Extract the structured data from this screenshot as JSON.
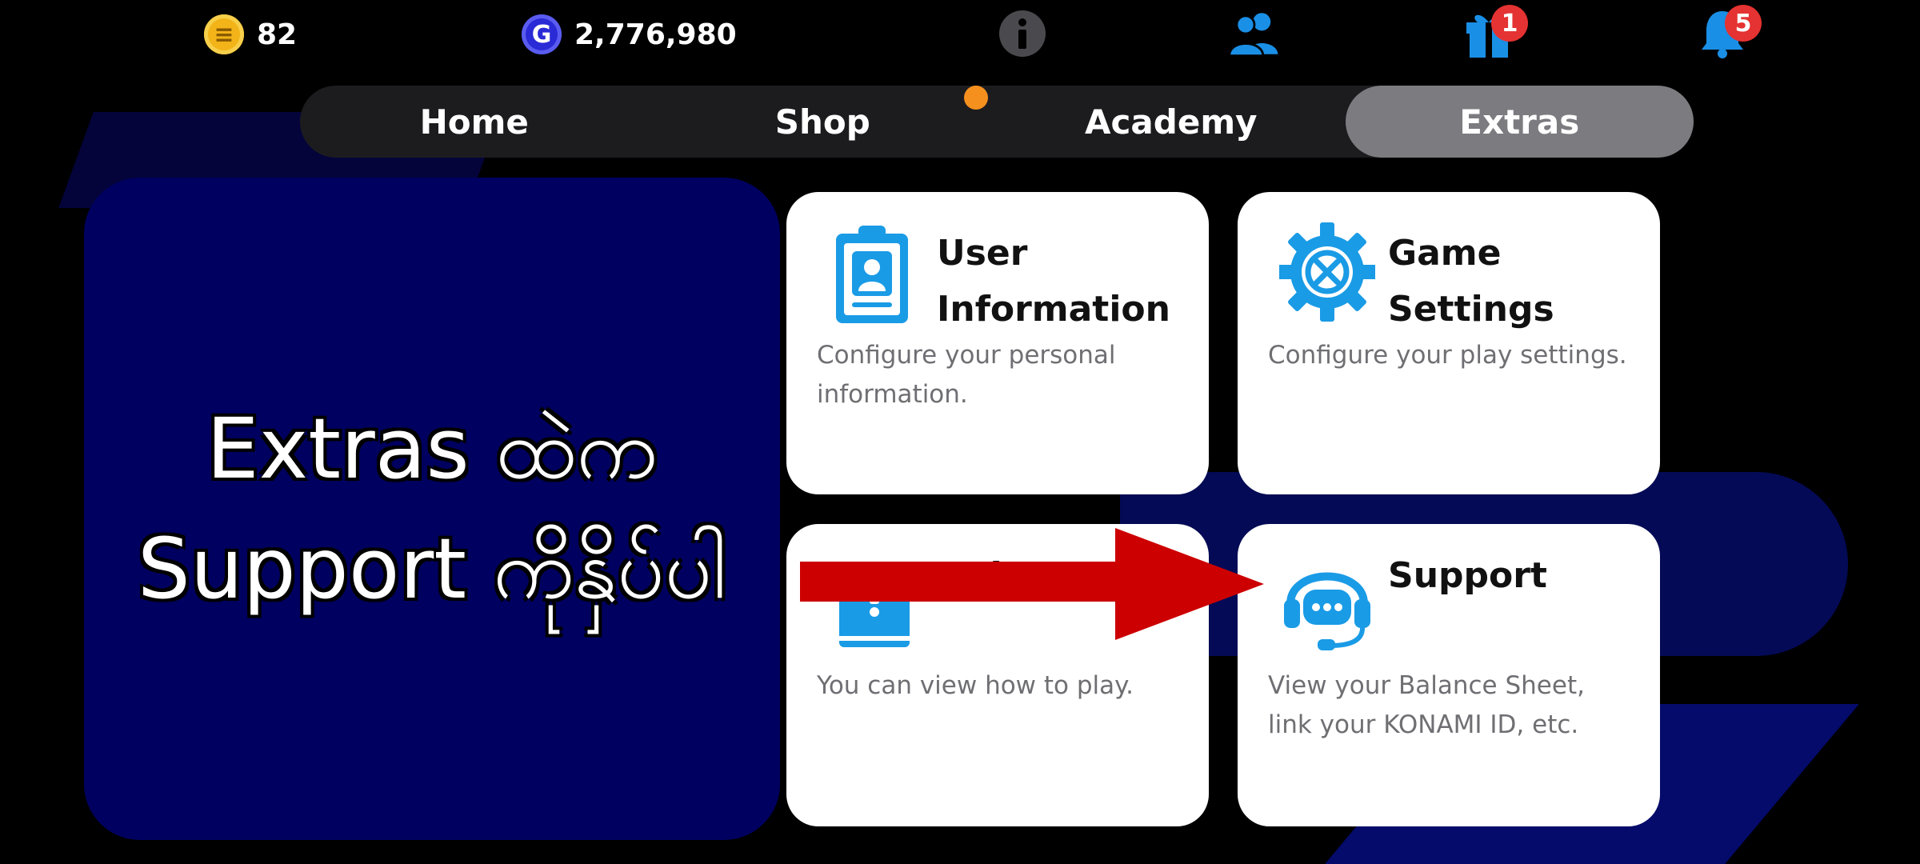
{
  "status_bar": {
    "coins_value": "82",
    "gems_value": "2,776,980",
    "gift_badge": "1",
    "bell_badge": "5"
  },
  "tabs": [
    {
      "label": "Home"
    },
    {
      "label": "Shop"
    },
    {
      "label": "Academy"
    },
    {
      "label": "Extras"
    }
  ],
  "overlay": {
    "line1": "Extras ထဲက",
    "line2": "Support ကိုနှိပ်ပါ"
  },
  "cards": {
    "user_info": {
      "title_l1": "User",
      "title_l2": "Information",
      "desc": "Configure your personal information."
    },
    "game_settings": {
      "title_l1": "Game",
      "title_l2": "Settings",
      "desc": "Configure your play settings."
    },
    "help": {
      "title": "Help",
      "desc": "You can view how to play."
    },
    "support": {
      "title": "Support",
      "desc": "View your Balance Sheet, link your KONAMI ID, etc."
    }
  },
  "colors": {
    "accent_blue": "#1a9be6",
    "arrow_red": "#cc0000",
    "tab_active": "#7b7b80",
    "badge_red": "#e53232",
    "panel_navy": "#000060"
  },
  "icons": [
    "coin-icon",
    "g-coin-icon",
    "info-icon",
    "friends-icon",
    "gift-icon",
    "bell-icon",
    "clipboard-user-icon",
    "gear-icon",
    "book-icon",
    "headset-icon",
    "arrow-right-icon"
  ]
}
